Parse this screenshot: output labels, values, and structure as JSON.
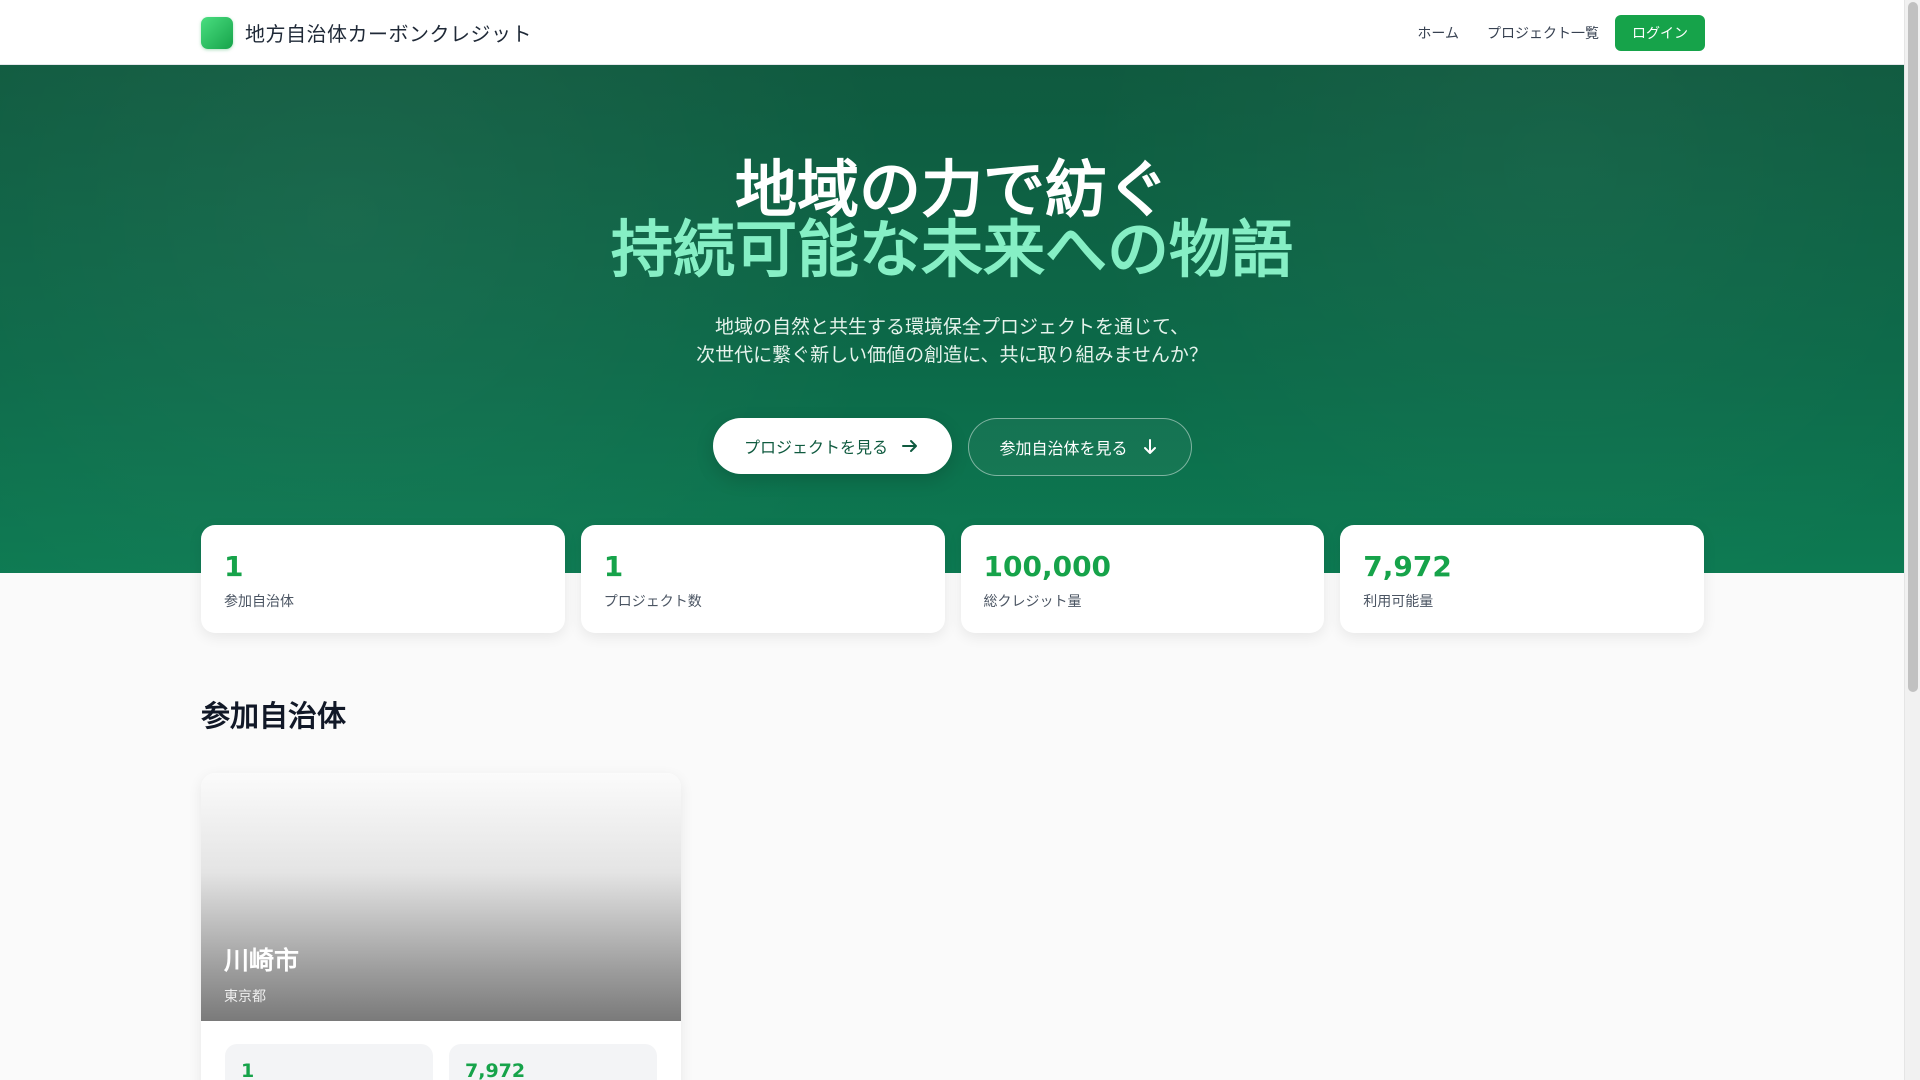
{
  "header": {
    "brand_name": "地方自治体カーボンクレジット",
    "nav": {
      "home": "ホーム",
      "projects": "プロジェクト一覧",
      "login": "ログイン"
    }
  },
  "hero": {
    "title_line1": "地域の力で紡ぐ",
    "title_line2": "持続可能な未来への物語",
    "subtitle_line1": "地域の自然と共生する環境保全プロジェクトを通じて、",
    "subtitle_line2": "次世代に繋ぐ新しい価値の創造に、共に取り組みませんか？",
    "primary_button": "プロジェクトを見る",
    "secondary_button": "参加自治体を見る"
  },
  "stats": [
    {
      "value": "1",
      "label": "参加自治体"
    },
    {
      "value": "1",
      "label": "プロジェクト数"
    },
    {
      "value": "100,000",
      "label": "総クレジット量"
    },
    {
      "value": "7,972",
      "label": "利用可能量"
    }
  ],
  "section": {
    "title": "参加自治体"
  },
  "municipalities": [
    {
      "name": "川崎市",
      "prefecture": "東京都",
      "stat_values": [
        "1",
        "7,972"
      ]
    }
  ],
  "colors": {
    "brand_green": "#16a34a",
    "hero_bg": "#0c6a49",
    "hero_accent": "#86efc5"
  },
  "icons": {
    "primary_button": "arrow-right-icon",
    "secondary_button": "arrow-down-icon",
    "logo": "logo-icon"
  }
}
